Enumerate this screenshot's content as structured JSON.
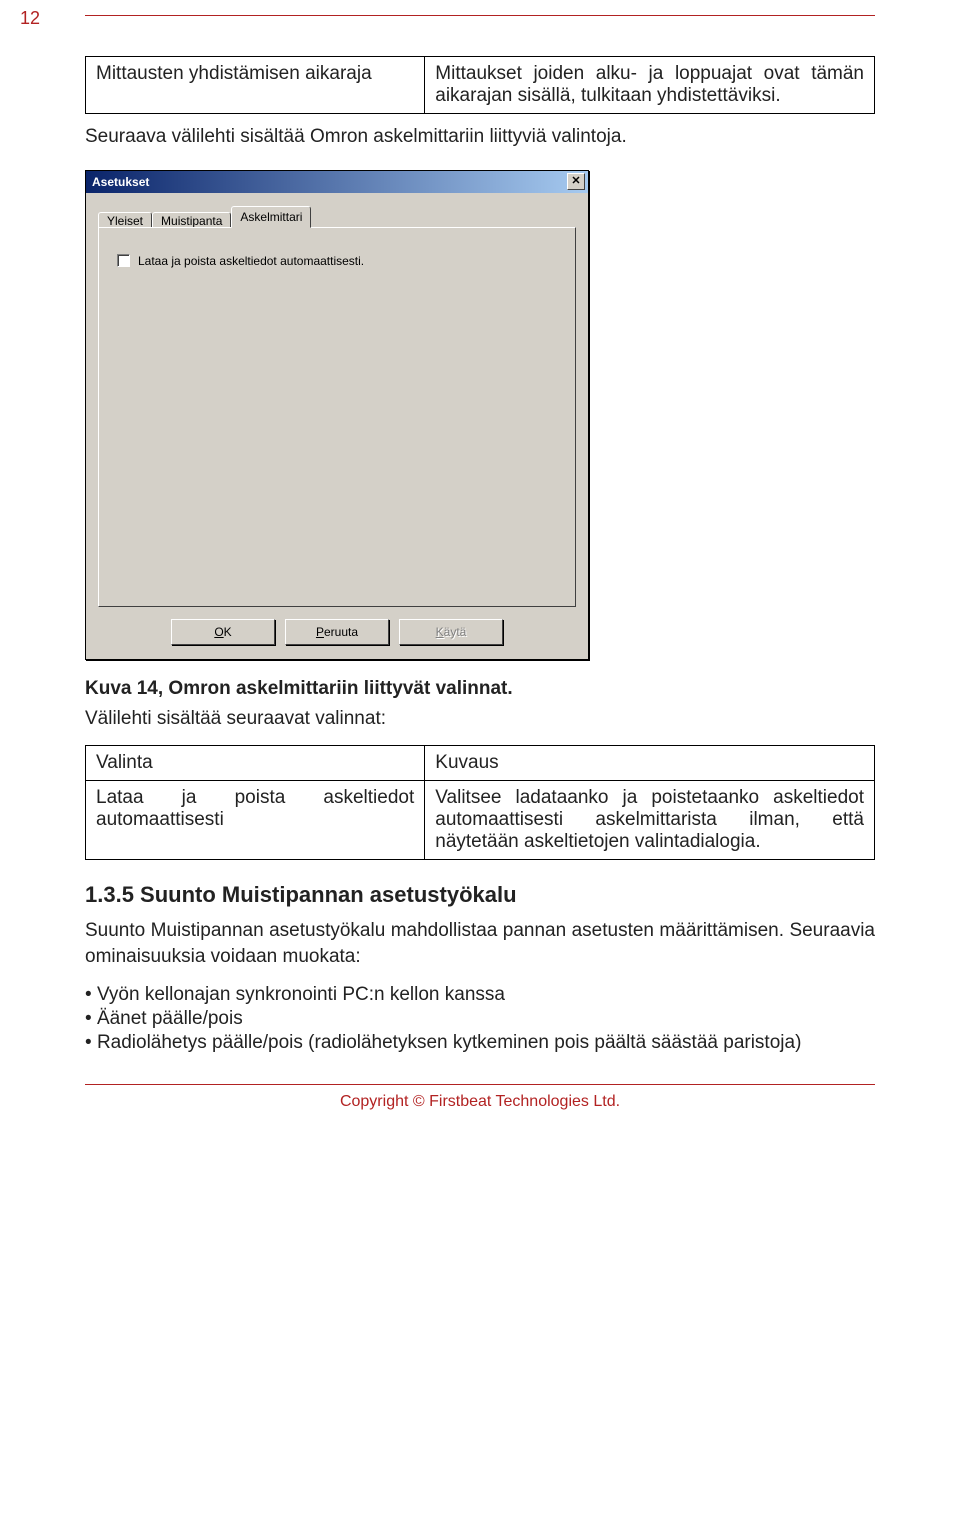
{
  "page_number": "12",
  "table1": {
    "left": "Mittausten yhdistämisen aikaraja",
    "right": "Mittaukset joiden alku- ja loppuajat ovat tämän aikarajan sisällä, tulkitaan yhdistettäviksi."
  },
  "para_after_table1": "Seuraava välilehti sisältää Omron askelmittariin liittyviä valintoja.",
  "dialog": {
    "title": "Asetukset",
    "tabs": [
      "Yleiset",
      "Muistipanta",
      "Askelmittari"
    ],
    "active_tab_index": 2,
    "checkbox_label": "Lataa ja poista askeltiedot automaattisesti.",
    "buttons": {
      "ok_u": "O",
      "ok_rest": "K",
      "cancel_u": "P",
      "cancel_rest": "eruuta",
      "apply_u": "K",
      "apply_rest": "äytä"
    }
  },
  "caption": "Kuva 14, Omron askelmittariin liittyvät valinnat.",
  "para_after_caption": "Välilehti sisältää seuraavat valinnat:",
  "table2": {
    "h_left": "Valinta",
    "h_right": "Kuvaus",
    "r_left": "Lataa ja poista askeltiedot automaattisesti",
    "r_right": "Valitsee ladataanko ja poistetaanko askeltiedot automaattisesti askelmittarista ilman, että näytetään askeltietojen valintadialogia."
  },
  "section_heading": "1.3.5  Suunto Muistipannan asetustyökalu",
  "para_section": "Suunto Muistipannan asetustyökalu mahdollistaa pannan asetusten määrittämisen. Seuraavia ominaisuuksia voidaan muokata:",
  "bullets": [
    "Vyön kellonajan synkronointi PC:n kellon kanssa",
    "Äänet päälle/pois",
    "Radiolähetys päälle/pois (radiolähetyksen kytkeminen pois päältä säästää paristoja)"
  ],
  "footer": "Copyright © Firstbeat Technologies Ltd."
}
